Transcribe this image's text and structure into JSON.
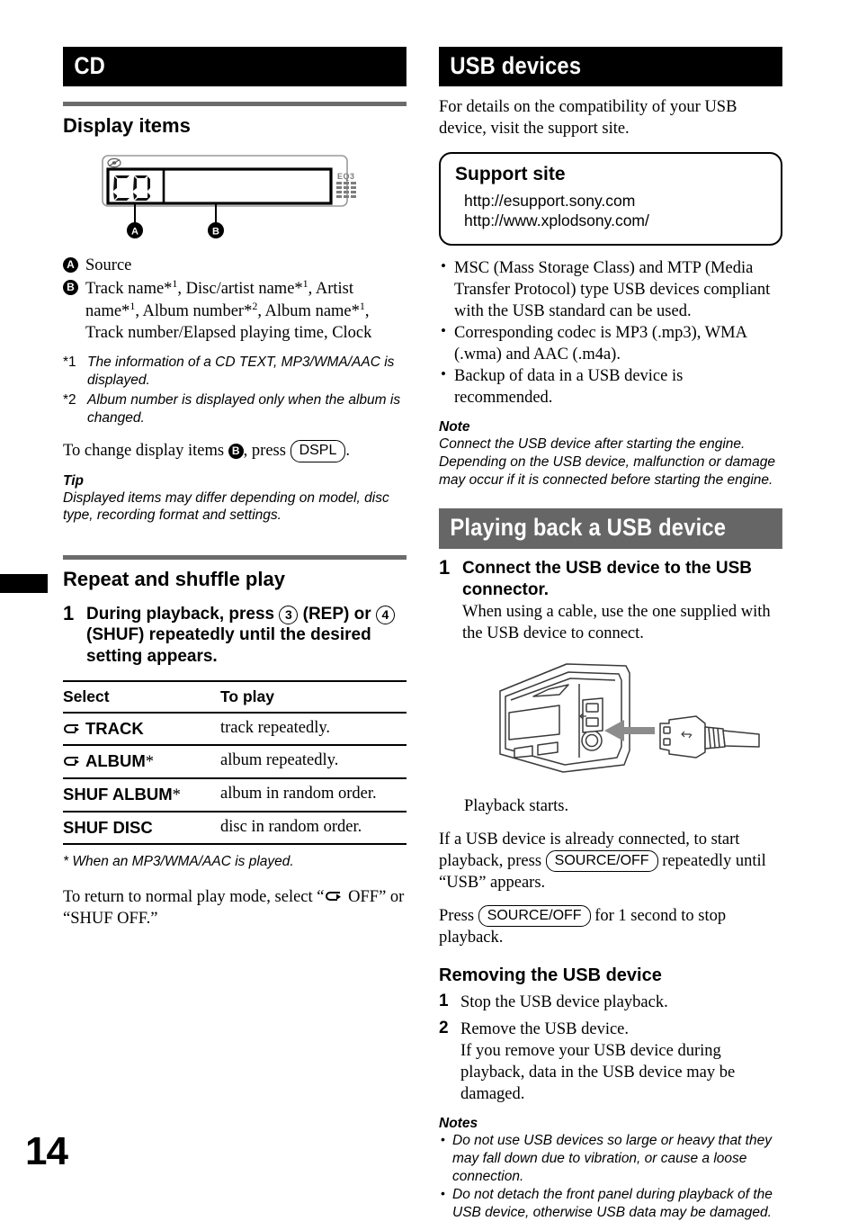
{
  "page": {
    "number": "14"
  },
  "left": {
    "banner": "CD",
    "display_items": {
      "heading": "Display items",
      "figure": {
        "screen_text": "CD",
        "eq_label": "EQ3",
        "callout_a": "A",
        "callout_b": "B"
      },
      "legend": [
        {
          "badge": "A",
          "text": "Source"
        },
        {
          "badge": "B",
          "text": "Track name*1, Disc/artist name*1, Artist name*1, Album number*2, Album name*1, Track number/Elapsed playing time, Clock"
        }
      ],
      "footnotes": [
        {
          "marker": "*1",
          "text": "The information of a CD TEXT, MP3/WMA/AAC is displayed."
        },
        {
          "marker": "*2",
          "text": "Album number is displayed only when the album is changed."
        }
      ],
      "change_line": {
        "pre": "To change display items ",
        "badge": "B",
        "mid": ", press ",
        "key": "DSPL",
        "post": "."
      },
      "tip_title": "Tip",
      "tip_text": "Displayed items may differ depending on model, disc type, recording format and settings."
    },
    "repeat_shuffle": {
      "heading": "Repeat and shuffle play",
      "step": {
        "num": "1",
        "part1": "During playback, press ",
        "key1": "3",
        "part2": " (REP) or ",
        "key2": "4",
        "part3": " (SHUF) repeatedly until the desired setting appears."
      },
      "table": {
        "headers": [
          "Select",
          "To play"
        ],
        "rows": [
          {
            "icon": "repeat-loop-icon",
            "select": "TRACK",
            "star": "",
            "play": "track repeatedly."
          },
          {
            "icon": "repeat-loop-icon",
            "select": "ALBUM",
            "star": "*",
            "play": "album repeatedly."
          },
          {
            "icon": "",
            "select": "SHUF ALBUM",
            "star": "*",
            "play": "album in random order."
          },
          {
            "icon": "",
            "select": "SHUF DISC",
            "star": "",
            "play": "disc in random order."
          }
        ]
      },
      "table_footnote": "* When an MP3/WMA/AAC is played.",
      "return_text": {
        "pre": "To return to normal play mode, select “",
        "icon": "repeat-loop-icon",
        "mid": " OFF” or “SHUF OFF.”"
      }
    }
  },
  "right": {
    "usb_devices": {
      "banner": "USB devices",
      "intro": "For details on the compatibility of your USB device, visit the support site.",
      "support": {
        "title": "Support site",
        "urls": [
          "http://esupport.sony.com",
          "http://www.xplodsony.com/"
        ]
      },
      "bullets": [
        "MSC (Mass Storage Class) and MTP (Media Transfer Protocol) type USB devices compliant with the USB standard can be used.",
        "Corresponding codec is MP3 (.mp3), WMA (.wma) and AAC (.m4a).",
        "Backup of data in a USB device is recommended."
      ],
      "note_title": "Note",
      "note_text": "Connect the USB device after starting the engine. Depending on the USB device, malfunction or damage may occur if it is connected before starting the engine."
    },
    "playing_back": {
      "banner": "Playing back a USB device",
      "step1": {
        "num": "1",
        "bold": "Connect the USB device to the USB connector.",
        "sub": "When using a cable, use the one supplied with the USB device to connect."
      },
      "figure_caption": "Playback starts.",
      "para_already": {
        "pre": "If a USB device is already connected, to start playback, press ",
        "key": "SOURCE/OFF",
        "post": " repeatedly until “USB” appears."
      },
      "para_stop": {
        "pre": "Press ",
        "key": "SOURCE/OFF",
        "post": " for 1 second to stop playback."
      },
      "removing": {
        "heading": "Removing the USB device",
        "steps": [
          {
            "num": "1",
            "text": "Stop the USB device playback."
          },
          {
            "num": "2",
            "text": "Remove the USB device.",
            "sub": "If you remove your USB device during playback, data in the USB device may be damaged."
          }
        ]
      },
      "notes_title": "Notes",
      "notes": [
        "Do not use USB devices so large or heavy that they may fall down due to vibration, or cause a loose connection.",
        "Do not detach the front panel during playback of the USB device, otherwise USB data may be damaged."
      ]
    }
  },
  "colors": {
    "banner_black": "#000000",
    "banner_gray": "#666666",
    "rule_gray": "#6b6b6b",
    "arrow_gray": "#8c8c8c"
  }
}
